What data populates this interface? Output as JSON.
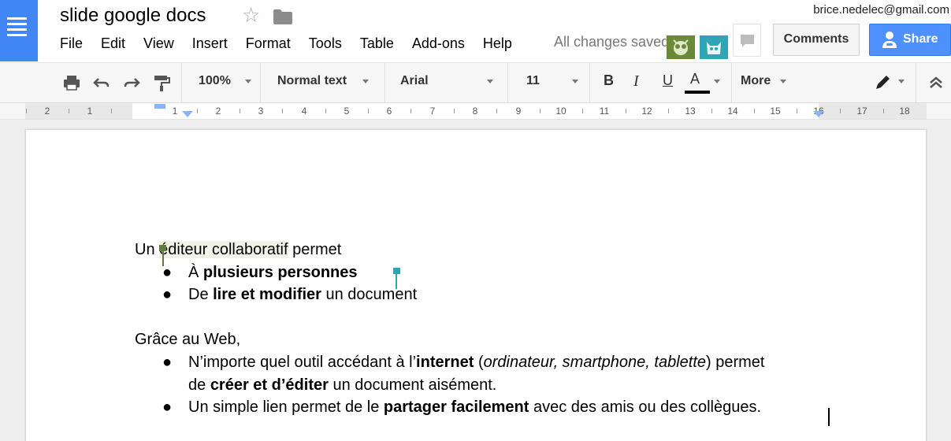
{
  "header": {
    "title": "slide google docs",
    "account": "brice.nedelec@gmail.com",
    "save_status": "All changes saved",
    "comments_label": "Comments",
    "share_label": "Share",
    "menu": [
      "File",
      "Edit",
      "View",
      "Insert",
      "Format",
      "Tools",
      "Table",
      "Add-ons",
      "Help"
    ]
  },
  "toolbar": {
    "zoom": "100%",
    "style": "Normal text",
    "font": "Arial",
    "size": "11",
    "more_label": "More",
    "bold_label": "B",
    "italic_label": "I",
    "underline_label": "U",
    "text_color_label": "A"
  },
  "ruler": {
    "numbers": [
      "2",
      "1",
      "1",
      "2",
      "3",
      "4",
      "5",
      "6",
      "7",
      "8",
      "9",
      "10",
      "11",
      "12",
      "13",
      "14",
      "15",
      "16",
      "17",
      "18"
    ]
  },
  "document": {
    "p1": {
      "a": "Un ",
      "b": "éditeur collaboratif",
      "c": " permet"
    },
    "b1": {
      "bullet": "●",
      "a": "À ",
      "b": "plusieurs personnes"
    },
    "b2": {
      "bullet": "●",
      "a": "De ",
      "b": "lire et modifier",
      "c": " un document"
    },
    "p2": "Grâce au Web,",
    "b3": {
      "bullet": "●",
      "a": "N’importe quel outil accédant à l’",
      "b": "internet",
      "c": " (",
      "d": "ordinateur, smartphone, tablette",
      "e": ") permet"
    },
    "b3cont": {
      "a": "de ",
      "b": "créer et d’éditer",
      "c": " un document aisément."
    },
    "b4": {
      "bullet": "●",
      "a": "Un simple lien permet de le ",
      "b": "partager facilement",
      "c": " avec des amis ou des collègues."
    }
  },
  "colors": {
    "brand_blue": "#4285f4",
    "share_blue": "#4d90fe",
    "collab_green": "#5e7d3a",
    "collab_teal": "#2fa5b5"
  }
}
